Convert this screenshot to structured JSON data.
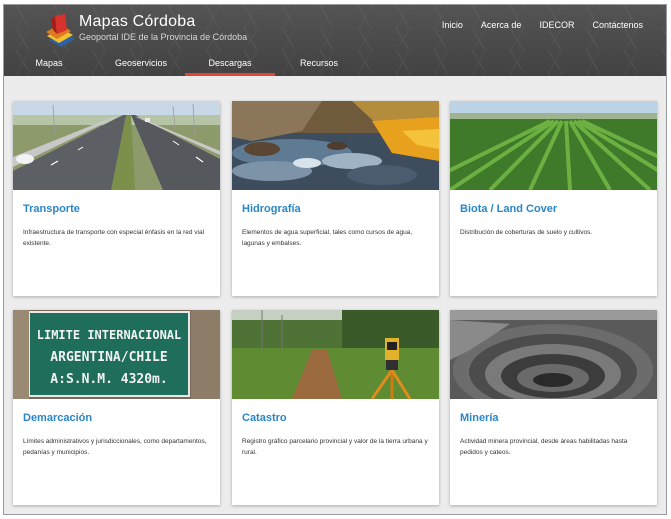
{
  "brand": {
    "title": "Mapas Córdoba",
    "subtitle": "Geoportal IDE de la Provincia de Córdoba",
    "logo_icon": "layered-map-sheets-icon"
  },
  "top_nav": [
    {
      "label": "Inicio"
    },
    {
      "label": "Acerca de"
    },
    {
      "label": "IDECOR"
    },
    {
      "label": "Contáctenos"
    }
  ],
  "main_nav": {
    "active_index": 2,
    "active_color": "#e0443a",
    "tabs": [
      {
        "label": "Mapas"
      },
      {
        "label": "Geoservicios"
      },
      {
        "label": "Descargas"
      },
      {
        "label": "Recursos"
      }
    ]
  },
  "accent_color": "#2a86c9",
  "cards": [
    {
      "title": "Transporte",
      "description": "Infraestructura de transporte con especial énfasis en la red vial existente.",
      "image": "highway-photo"
    },
    {
      "title": "Hidrografía",
      "description": "Elementos de agua superficial, tales como cursos de agua, lagunas y embalses.",
      "image": "river-photo"
    },
    {
      "title": "Biota / Land Cover",
      "description": "Distribución de coberturas de suelo y cultivos.",
      "image": "crop-field-photo"
    },
    {
      "title": "Demarcación",
      "description": "Límites administrativos y jurisdiccionales, como departamentos, pedanías y municipios.",
      "image": "border-sign-photo",
      "image_sign_lines": [
        "LIMITE INTERNACIONAL",
        "ARGENTINA/CHILE",
        "A:S.N.M.  4320m."
      ]
    },
    {
      "title": "Catastro",
      "description": "Registro gráfico parcelario provincial y valor de la tierra urbana y rural.",
      "image": "survey-instrument-photo"
    },
    {
      "title": "Minería",
      "description": "Actividad minera provincial, desde áreas habilitadas hasta pedidos y cateos.",
      "image": "open-pit-mine-photo"
    }
  ]
}
